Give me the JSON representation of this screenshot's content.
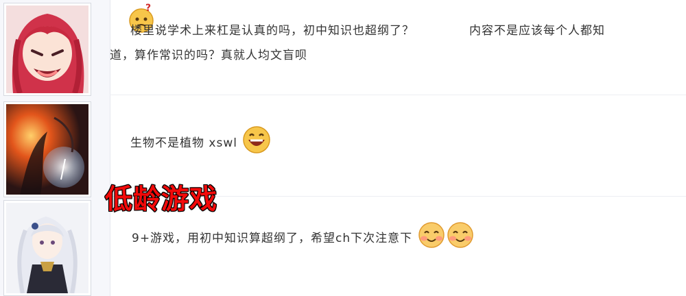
{
  "posts": [
    {
      "avatar": "red-haired-anime-girl-avatar",
      "emoji": "confused-face-emoji",
      "line1": "楼里说学术上来杠是认真的吗，初中知识也超纲了？",
      "line1_tail": "内容不是应该每个人都知",
      "line2": "道，算作常识的吗？真就人均文盲呗"
    },
    {
      "avatar": "dark-fire-fantasy-avatar",
      "text": "生物不是植物 xswl",
      "emoji": "laughing-face-emoji"
    },
    {
      "avatar": "white-haired-anime-girl-avatar",
      "text": "9+游戏，用初中知识算超纲了，希望ch下次注意下",
      "emojis": [
        "blushing-face-emoji",
        "blushing-face-emoji"
      ]
    }
  ],
  "overlay": {
    "label": "低龄游戏",
    "color": "#f20a0a"
  }
}
